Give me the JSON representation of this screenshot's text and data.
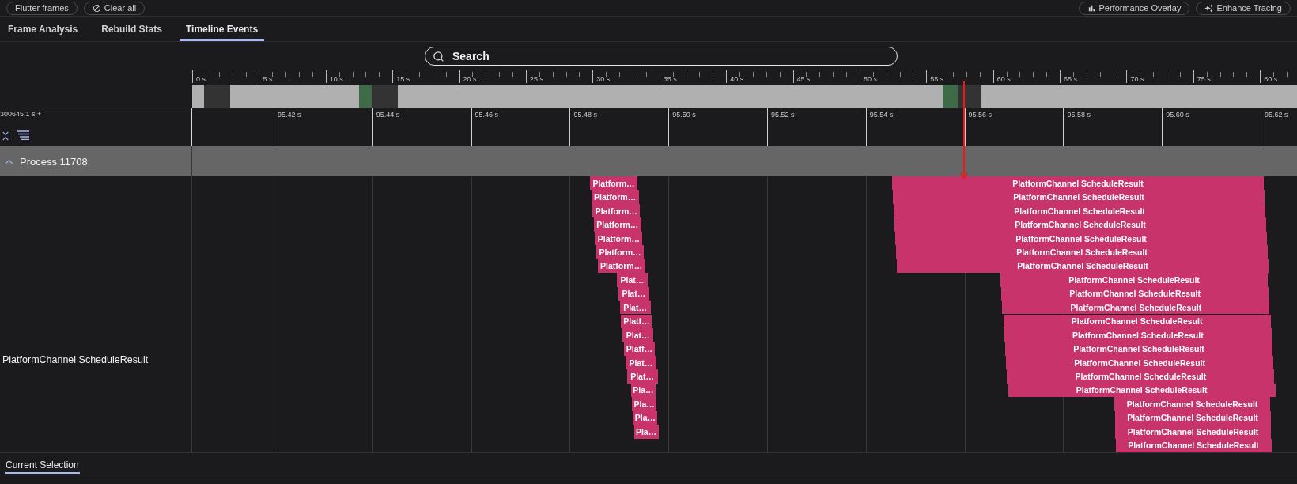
{
  "toolbar": {
    "left_buttons": [
      {
        "label": "Flutter frames"
      },
      {
        "label": "Clear all"
      }
    ],
    "right_buttons": [
      {
        "label": "Performance Overlay"
      },
      {
        "label": "Enhance Tracing"
      }
    ]
  },
  "tabs": [
    {
      "label": "Frame Analysis",
      "selected": false
    },
    {
      "label": "Rebuild Stats",
      "selected": false
    },
    {
      "label": "Timeline Events",
      "selected": true
    }
  ],
  "search": {
    "placeholder": "Search"
  },
  "overview_ruler": {
    "ticks": [
      "0 s",
      "5 s",
      "10 s",
      "15 s",
      "20 s",
      "25 s",
      "30 s",
      "35 s",
      "40 s",
      "45 s",
      "50 s",
      "55 s",
      "60 s",
      "65 s",
      "70 s",
      "75 s",
      "80 s"
    ]
  },
  "detail_ruler": {
    "offset": "300645.1 s +",
    "ticks": [
      "95.42 s",
      "95.44 s",
      "95.46 s",
      "95.48 s",
      "95.50 s",
      "95.52 s",
      "95.54 s",
      "95.56 s",
      "95.58 s",
      "95.60 s",
      "95.62 s"
    ]
  },
  "process": {
    "name": "Process 11708",
    "expanded": true
  },
  "track": {
    "label": "PlatformChannel ScheduleResult",
    "groups": [
      {
        "events": [
          {
            "label": "Platform…"
          },
          {
            "label": "Platform…"
          },
          {
            "label": "Platform…"
          },
          {
            "label": "Platform…"
          },
          {
            "label": "Platform…"
          },
          {
            "label": "Platform…"
          },
          {
            "label": "Platform…"
          },
          {
            "label": "Plat…"
          },
          {
            "label": "Plat…"
          },
          {
            "label": "Plat…"
          },
          {
            "label": "Platf…"
          },
          {
            "label": "Plat…"
          },
          {
            "label": "Platf…"
          },
          {
            "label": "Plat…"
          },
          {
            "label": "Plat…"
          },
          {
            "label": "Pla…"
          },
          {
            "label": "Pla…"
          },
          {
            "label": "Pla…"
          },
          {
            "label": "Pla…"
          }
        ]
      },
      {
        "events": [
          {
            "label": "PlatformChannel ScheduleResult"
          },
          {
            "label": "PlatformChannel ScheduleResult"
          },
          {
            "label": "PlatformChannel ScheduleResult"
          },
          {
            "label": "PlatformChannel ScheduleResult"
          },
          {
            "label": "PlatformChannel ScheduleResult"
          },
          {
            "label": "PlatformChannel ScheduleResult"
          },
          {
            "label": "PlatformChannel ScheduleResult"
          },
          {
            "label": "PlatformChannel ScheduleResult"
          },
          {
            "label": "PlatformChannel ScheduleResult"
          },
          {
            "label": "PlatformChannel ScheduleResult"
          },
          {
            "label": "PlatformChannel ScheduleResult"
          },
          {
            "label": "PlatformChannel ScheduleResult"
          },
          {
            "label": "PlatformChannel ScheduleResult"
          },
          {
            "label": "PlatformChannel ScheduleResult"
          },
          {
            "label": "PlatformChannel ScheduleResult"
          },
          {
            "label": "PlatformChannel ScheduleResult"
          },
          {
            "label": "PlatformChannel ScheduleResult"
          },
          {
            "label": "PlatformChannel ScheduleResult"
          },
          {
            "label": "PlatformChannel ScheduleResult"
          },
          {
            "label": "PlatformChannel ScheduleResult"
          }
        ]
      }
    ]
  },
  "bottom_tabs": [
    {
      "label": "Current Selection",
      "selected": true
    }
  ]
}
